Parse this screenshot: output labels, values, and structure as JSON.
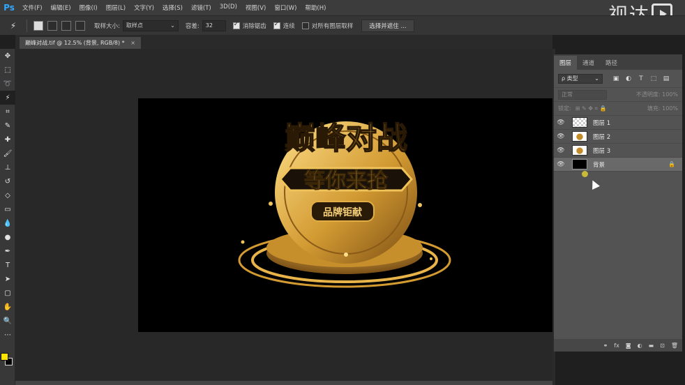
{
  "app": {
    "logo": "Ps"
  },
  "menu": [
    "文件(F)",
    "编辑(E)",
    "图像(I)",
    "图层(L)",
    "文字(Y)",
    "选择(S)",
    "滤镜(T)",
    "3D(D)",
    "视图(V)",
    "窗口(W)",
    "帮助(H)"
  ],
  "watermark": {
    "text": "视达"
  },
  "options": {
    "sample_size_label": "取样大小:",
    "sample_size_value": "取样点",
    "tolerance_label": "容差:",
    "tolerance_value": "32",
    "antialias_label": "消除锯齿",
    "contiguous_label": "连续",
    "sample_all_label": "对所有图层取样",
    "select_mask_button": "选择并遮住 ..."
  },
  "document": {
    "tab_title": "巅峰对战.tif @ 12.5% (背景, RGB/8) *",
    "close": "×"
  },
  "artwork": {
    "headline": "巅峰对战",
    "subline": "等你来抢",
    "badge": "品牌钜献"
  },
  "layers_panel": {
    "tabs": [
      "图层",
      "通道",
      "路径"
    ],
    "kind_filter": "ρ 类型",
    "blend_mode": "正常",
    "opacity_label": "不透明度: 100%",
    "lock_label": "锁定:",
    "fill_label": "填充: 100%",
    "layers": [
      {
        "name": "图层 1",
        "thumb": "checker",
        "locked": false
      },
      {
        "name": "图层 2",
        "thumb": "img",
        "locked": false
      },
      {
        "name": "图层 3",
        "thumb": "img",
        "locked": false
      },
      {
        "name": "背景",
        "thumb": "black",
        "locked": true
      }
    ]
  },
  "colors": {
    "foreground": "#ffe600",
    "background": "#000000",
    "accent": "#31a8ff"
  }
}
